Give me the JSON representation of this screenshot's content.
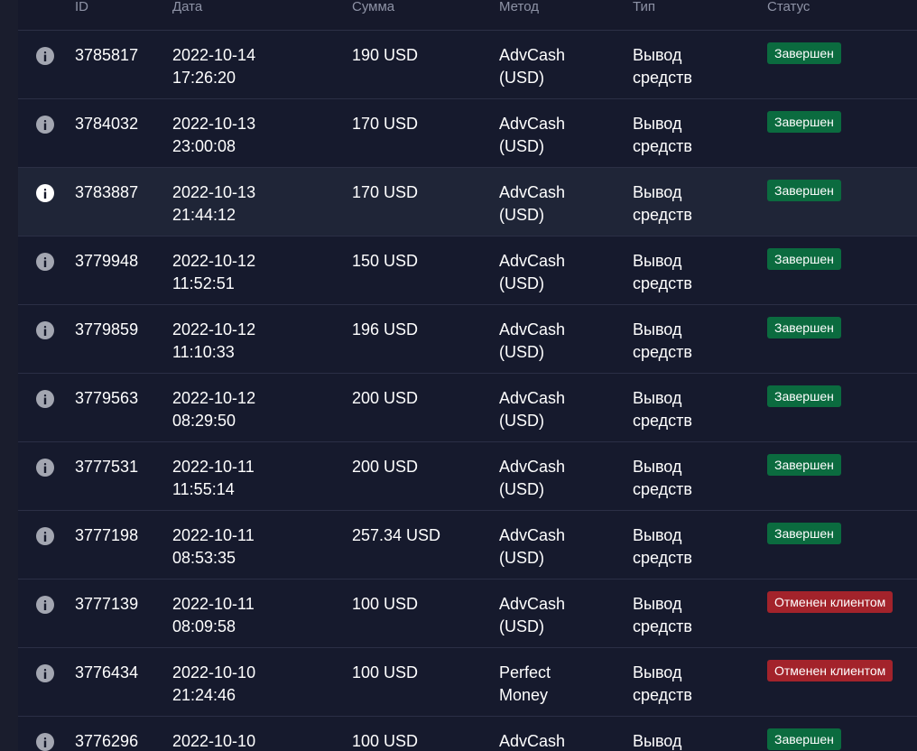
{
  "colors": {
    "background": "#16192b",
    "row_highlight": "#1f2537",
    "status_done": "#0b6b3f",
    "status_cancel": "#a3232b",
    "header_text": "#8e93a6"
  },
  "columns": {
    "id": "ID",
    "date": "Дата",
    "amount": "Сумма",
    "method": "Метод",
    "type": "Тип",
    "status": "Статус"
  },
  "rows": [
    {
      "id": "3785817",
      "date1": "2022-10-14",
      "date2": "17:26:20",
      "amount": "190 USD",
      "method1": "AdvCash",
      "method2": "(USD)",
      "type1": "Вывод",
      "type2": "средств",
      "status": "Завершен",
      "status_kind": "done"
    },
    {
      "id": "3784032",
      "date1": "2022-10-13",
      "date2": "23:00:08",
      "amount": "170 USD",
      "method1": "AdvCash",
      "method2": "(USD)",
      "type1": "Вывод",
      "type2": "средств",
      "status": "Завершен",
      "status_kind": "done"
    },
    {
      "id": "3783887",
      "date1": "2022-10-13",
      "date2": "21:44:12",
      "amount": "170 USD",
      "method1": "AdvCash",
      "method2": "(USD)",
      "type1": "Вывод",
      "type2": "средств",
      "status": "Завершен",
      "status_kind": "done",
      "highlighted": true
    },
    {
      "id": "3779948",
      "date1": "2022-10-12",
      "date2": "11:52:51",
      "amount": "150 USD",
      "method1": "AdvCash",
      "method2": "(USD)",
      "type1": "Вывод",
      "type2": "средств",
      "status": "Завершен",
      "status_kind": "done"
    },
    {
      "id": "3779859",
      "date1": "2022-10-12",
      "date2": "11:10:33",
      "amount": "196 USD",
      "method1": "AdvCash",
      "method2": "(USD)",
      "type1": "Вывод",
      "type2": "средств",
      "status": "Завершен",
      "status_kind": "done"
    },
    {
      "id": "3779563",
      "date1": "2022-10-12",
      "date2": "08:29:50",
      "amount": "200 USD",
      "method1": "AdvCash",
      "method2": "(USD)",
      "type1": "Вывод",
      "type2": "средств",
      "status": "Завершен",
      "status_kind": "done"
    },
    {
      "id": "3777531",
      "date1": "2022-10-11",
      "date2": "11:55:14",
      "amount": "200 USD",
      "method1": "AdvCash",
      "method2": "(USD)",
      "type1": "Вывод",
      "type2": "средств",
      "status": "Завершен",
      "status_kind": "done"
    },
    {
      "id": "3777198",
      "date1": "2022-10-11",
      "date2": "08:53:35",
      "amount": "257.34 USD",
      "method1": "AdvCash",
      "method2": "(USD)",
      "type1": "Вывод",
      "type2": "средств",
      "status": "Завершен",
      "status_kind": "done"
    },
    {
      "id": "3777139",
      "date1": "2022-10-11",
      "date2": "08:09:58",
      "amount": "100 USD",
      "method1": "AdvCash",
      "method2": "(USD)",
      "type1": "Вывод",
      "type2": "средств",
      "status": "Отменен клиентом",
      "status_kind": "cancel"
    },
    {
      "id": "3776434",
      "date1": "2022-10-10",
      "date2": "21:24:46",
      "amount": "100 USD",
      "method1": "Perfect",
      "method2": "Money",
      "type1": "Вывод",
      "type2": "средств",
      "status": "Отменен клиентом",
      "status_kind": "cancel"
    },
    {
      "id": "3776296",
      "date1": "2022-10-10",
      "date2": "",
      "amount": "100 USD",
      "method1": "AdvCash",
      "method2": "",
      "type1": "Вывод",
      "type2": "",
      "status": "Завершен",
      "status_kind": "done"
    }
  ]
}
